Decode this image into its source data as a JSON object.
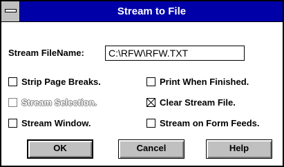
{
  "window": {
    "title": "Stream to File",
    "system_menu_icon": "system-menu-bar"
  },
  "filename": {
    "label": "Stream FileName:",
    "value": "C:\\RFW\\RFW.TXT"
  },
  "options": [
    {
      "label": "Strip Page Breaks.",
      "checked": false,
      "enabled": true
    },
    {
      "label": "Print When Finished.",
      "checked": false,
      "enabled": true
    },
    {
      "label": "Stream Selection.",
      "checked": false,
      "enabled": false
    },
    {
      "label": "Clear Stream File.",
      "checked": true,
      "enabled": true
    },
    {
      "label": "Stream Window.",
      "checked": false,
      "enabled": true
    },
    {
      "label": "Stream on Form Feeds.",
      "checked": false,
      "enabled": true
    }
  ],
  "buttons": {
    "ok": "OK",
    "cancel": "Cancel",
    "help": "Help"
  },
  "colors": {
    "titlebar": "#0000a8",
    "button_face": "#c0c0c0"
  }
}
